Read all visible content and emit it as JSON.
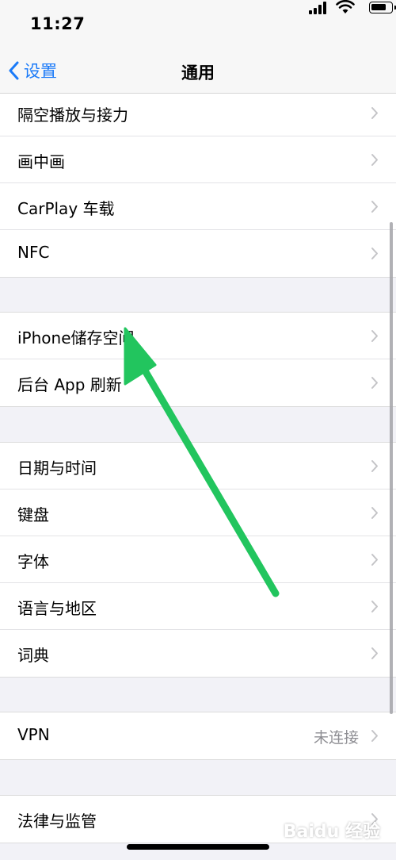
{
  "status_bar": {
    "time": "11:27",
    "icons": [
      "cellular-signal-icon",
      "wifi-icon",
      "battery-icon"
    ]
  },
  "nav": {
    "back_label": "设置",
    "title": "通用"
  },
  "groups": [
    {
      "items": [
        {
          "label": "隔空播放与接力"
        },
        {
          "label": "画中画"
        },
        {
          "label": "CarPlay 车载"
        },
        {
          "label": "NFC"
        }
      ]
    },
    {
      "items": [
        {
          "label": "iPhone储存空间"
        },
        {
          "label": "后台 App 刷新"
        }
      ]
    },
    {
      "items": [
        {
          "label": "日期与时间"
        },
        {
          "label": "键盘"
        },
        {
          "label": "字体"
        },
        {
          "label": "语言与地区"
        },
        {
          "label": "词典"
        }
      ]
    },
    {
      "items": [
        {
          "label": "VPN",
          "value": "未连接"
        }
      ]
    },
    {
      "items": [
        {
          "label": "法律与监管"
        }
      ]
    }
  ],
  "colors": {
    "accent": "#1a7af8",
    "annotation_arrow": "#22c55e",
    "background": "#f2f2f7"
  },
  "watermark": "Baidu 经验"
}
